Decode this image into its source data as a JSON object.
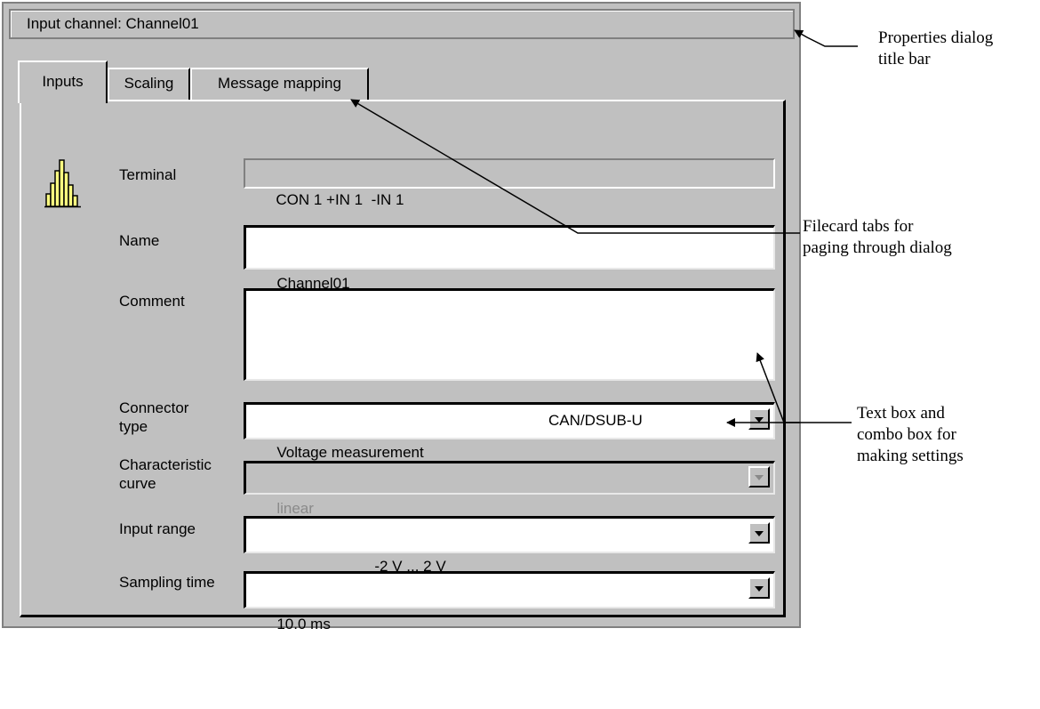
{
  "dialog": {
    "title": "Input channel: Channel01",
    "tabs": [
      {
        "label": "Inputs",
        "active": true
      },
      {
        "label": "Scaling",
        "active": false
      },
      {
        "label": "Message mapping",
        "active": false
      }
    ],
    "icon": "histogram-icon",
    "fields": {
      "terminal": {
        "label": "Terminal",
        "value": "CON 1 +IN 1  -IN 1"
      },
      "name": {
        "label": "Name",
        "value": "Channel01"
      },
      "comment": {
        "label": "Comment",
        "value": ""
      },
      "connector": {
        "label_line1": "Connector",
        "label_line2": "type",
        "value": "Voltage measurement",
        "value2": "CAN/DSUB-U"
      },
      "curve": {
        "label_line1": "Characteristic",
        "label_line2": "curve",
        "value": "linear",
        "disabled": true
      },
      "input_range": {
        "label": "Input range",
        "value": "-2 V ... 2 V"
      },
      "sampling_time": {
        "label": "Sampling time",
        "value": "10.0 ms"
      }
    }
  },
  "annotations": {
    "titlebar": {
      "line1": "Properties dialog",
      "line2": "title bar"
    },
    "tabs": {
      "line1": "Filecard tabs for",
      "line2": "paging through dialog"
    },
    "settings": {
      "line1": "Text box and",
      "line2": "combo box for",
      "line3": "making settings"
    }
  },
  "colors": {
    "face": "#c0c0c0",
    "shadow": "#808080",
    "highlight": "#ffffff",
    "icon_fill": "#ffff80"
  }
}
